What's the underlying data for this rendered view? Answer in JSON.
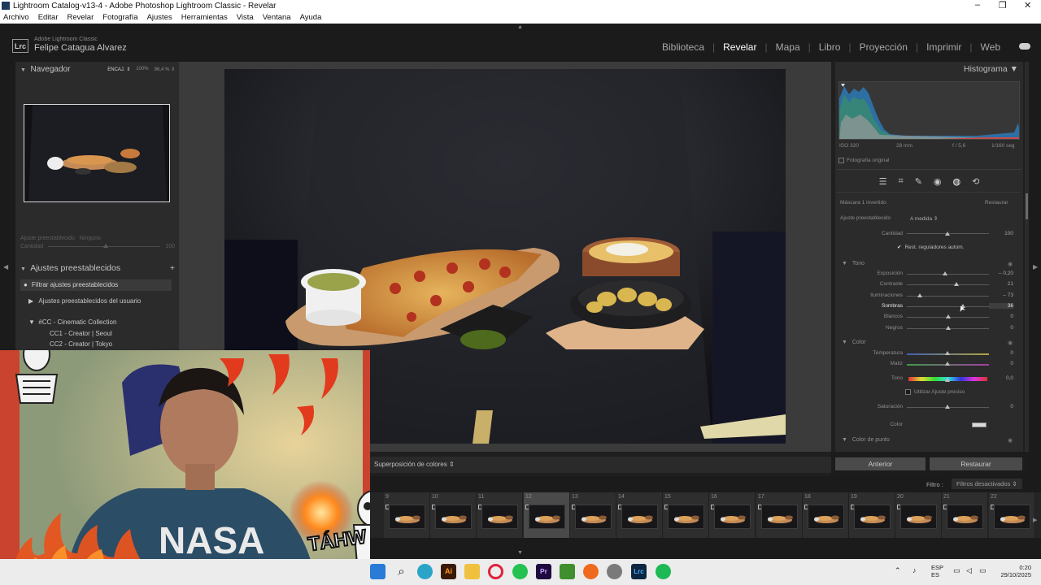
{
  "window": {
    "title": "Lightroom Catalog-v13-4 - Adobe Photoshop Lightroom Classic - Revelar",
    "controls": {
      "minimize": "–",
      "maximize": "❐",
      "close": "✕"
    }
  },
  "menu": [
    "Archivo",
    "Editar",
    "Revelar",
    "Fotografía",
    "Ajustes",
    "Herramientas",
    "Vista",
    "Ventana",
    "Ayuda"
  ],
  "identity": {
    "badge": "Lrc",
    "product": "Adobe Lightroom Classic",
    "user": "Felipe Catagua Alvarez"
  },
  "modules": [
    "Biblioteca",
    "Revelar",
    "Mapa",
    "Libro",
    "Proyección",
    "Imprimir",
    "Web"
  ],
  "active_module": "Revelar",
  "navigator": {
    "title": "Navegador",
    "zoom_fit": "ENCAJ. ⇕",
    "zoom_100": "100%",
    "zoom_custom": "96,4 % ⇕"
  },
  "nav_preset": {
    "label": "Ajuste preestablecido",
    "value": "Ninguno",
    "amount_label": "Cantidad",
    "amount_value": "100"
  },
  "presets": {
    "title": "Ajustes preestablecidos",
    "add": "+",
    "filter": "Filtrar ajustes preestablecidos",
    "user": "Ajustes preestablecidos del usuario",
    "cc_group": "#CC - Cinematic Collection",
    "cc1": "CC1 - Creator | Seoul",
    "cc2": "CC2 - Creator | Tokyo"
  },
  "histogram": {
    "title": "Histograma",
    "iso": "ISO 320",
    "focal": "28 mm",
    "aperture": "f / 5,6",
    "shutter": "1/160 seg",
    "original": "Fotografía original"
  },
  "tool_icons": [
    "sliders-icon",
    "crop-icon",
    "heal-icon",
    "redeye-icon",
    "mask-icon",
    "history-icon"
  ],
  "mask": {
    "title": "Máscara 1 invertido",
    "reset": "Restaurar",
    "preset_label": "Ajuste preestablecido",
    "preset_value": "A medida ⇕",
    "amount_label": "Cantidad",
    "amount_value": "100",
    "auto_reset": "Rest. reguladores autom."
  },
  "tone": {
    "title": "Tono",
    "sliders": [
      {
        "label": "Exposición",
        "value": "– 0,20",
        "position": 0.47
      },
      {
        "label": "Contraste",
        "value": "21",
        "position": 0.6
      },
      {
        "label": "Iluminaciones",
        "value": "– 73",
        "position": 0.16
      },
      {
        "label": "Sombras",
        "value": "36",
        "position": 0.68
      },
      {
        "label": "Blancos",
        "value": "0",
        "position": 0.5
      },
      {
        "label": "Negros",
        "value": "0",
        "position": 0.5
      }
    ]
  },
  "color": {
    "title": "Color",
    "temperature": {
      "label": "Temperatura",
      "value": "0",
      "position": 0.5
    },
    "tint": {
      "label": "Matiz",
      "value": "0",
      "position": 0.5
    },
    "hue": {
      "label": "Tono",
      "value": "0,0",
      "position": 0.5
    },
    "fine": "Utilizar Ajuste preciso",
    "saturation": {
      "label": "Saturación",
      "value": "0",
      "position": 0.5
    },
    "color_label": "Color",
    "point_color": "Color de punto"
  },
  "buttons": {
    "previous": "Anterior",
    "reset": "Restaurar"
  },
  "toolbar": {
    "overlay": "Superposición de colores ⇕"
  },
  "filmstrip": {
    "filter_label": "Filtro :",
    "filter_value": "Filtros desactivados ⇕",
    "numbers": [
      "9",
      "10",
      "11",
      "12",
      "13",
      "14",
      "15",
      "16",
      "17",
      "18",
      "19",
      "20",
      "21",
      "22"
    ],
    "selected_index": 3
  },
  "overlay": {
    "sticker": "TÁHW"
  },
  "tray": {
    "lang1": "ESP",
    "lang2": "ES",
    "time": "0:20",
    "date": "29/10/2025"
  },
  "taskbar_icons": [
    "windows-icon",
    "search-icon",
    "edge-icon",
    "illustrator-icon",
    "file-explorer-icon",
    "opera-icon",
    "whatsapp-icon",
    "premiere-icon",
    "minecraft-icon",
    "firefox-icon",
    "settings-icon",
    "lightroom-icon",
    "spotify-icon"
  ],
  "colors": {
    "accent": "#ffffff",
    "panel": "#2b2b2b",
    "canvas": "#3b3b3b"
  }
}
